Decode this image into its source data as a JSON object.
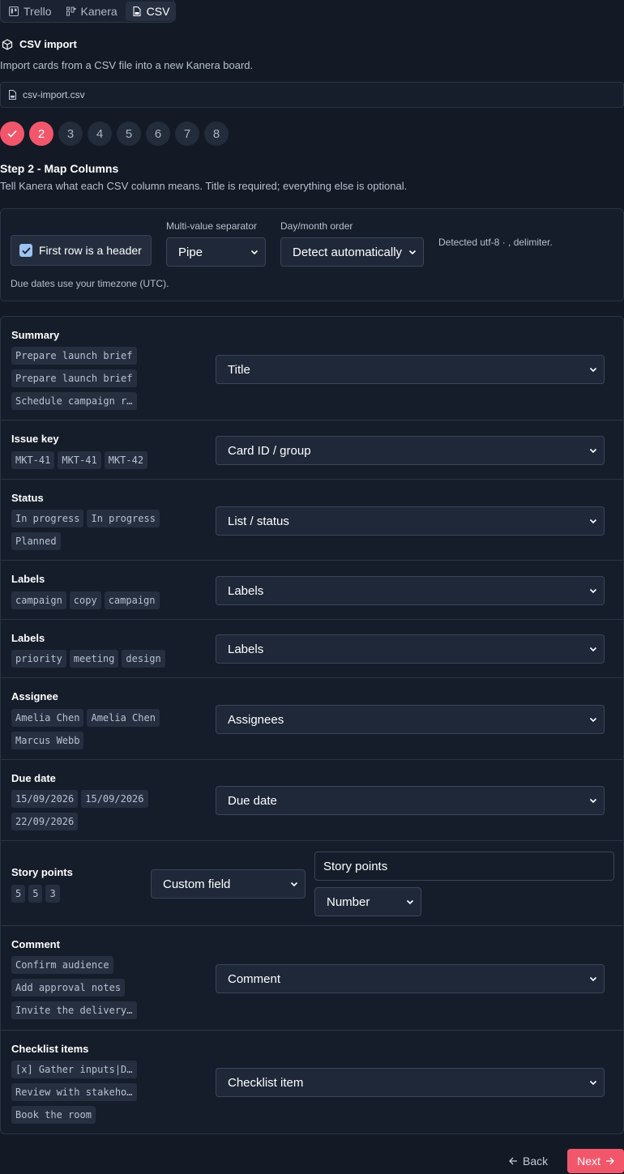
{
  "source_tabs": [
    {
      "label": "Trello",
      "icon": "trello-icon",
      "active": false
    },
    {
      "label": "Kanera",
      "icon": "kanera-icon",
      "active": false
    },
    {
      "label": "CSV",
      "icon": "csv-file-icon",
      "active": true
    }
  ],
  "import": {
    "title": "CSV import",
    "description": "Import cards from a CSV file into a new Kanera board.",
    "file_name": "csv-import.csv"
  },
  "steps": [
    "✓",
    "2",
    "3",
    "4",
    "5",
    "6",
    "7",
    "8"
  ],
  "step": {
    "title": "Step 2 - Map Columns",
    "description": "Tell Kanera what each CSV column means. Title is required; everything else is optional."
  },
  "options": {
    "header_checkbox_label": "First row is a header",
    "header_checked": true,
    "separator_label": "Multi-value separator",
    "separator_value": "Pipe",
    "order_label": "Day/month order",
    "order_value": "Detect automatically",
    "detected": "Detected utf-8 · , delimiter.",
    "timezone_note": "Due dates use your timezone (UTC)."
  },
  "columns": [
    {
      "name": "Summary",
      "samples": [
        "Prepare launch brief",
        "Prepare launch brief",
        "Schedule campaign r…"
      ],
      "mapping": "Title"
    },
    {
      "name": "Issue key",
      "samples": [
        "MKT-41",
        "MKT-41",
        "MKT-42"
      ],
      "mapping": "Card ID / group"
    },
    {
      "name": "Status",
      "samples": [
        "In progress",
        "In progress",
        "Planned"
      ],
      "mapping": "List / status"
    },
    {
      "name": "Labels",
      "samples": [
        "campaign",
        "copy",
        "campaign"
      ],
      "mapping": "Labels"
    },
    {
      "name": "Labels",
      "samples": [
        "priority",
        "meeting",
        "design"
      ],
      "mapping": "Labels"
    },
    {
      "name": "Assignee",
      "samples": [
        "Amelia Chen",
        "Amelia Chen",
        "Marcus Webb"
      ],
      "mapping": "Assignees"
    },
    {
      "name": "Due date",
      "samples": [
        "15/09/2026",
        "15/09/2026",
        "22/09/2026"
      ],
      "mapping": "Due date"
    },
    {
      "name": "Story points",
      "samples": [
        "5",
        "5",
        "3"
      ],
      "mapping": "Custom field",
      "custom_name": "Story points",
      "custom_type": "Number"
    },
    {
      "name": "Comment",
      "samples": [
        "Confirm audience",
        "Add approval notes",
        "Invite the delivery…"
      ],
      "mapping": "Comment"
    },
    {
      "name": "Checklist items",
      "samples": [
        "[x] Gather inputs|D…",
        "Review with stakeho…",
        "Book the room"
      ],
      "mapping": "Checklist item"
    }
  ],
  "nav": {
    "back": "Back",
    "next": "Next"
  },
  "colors": {
    "accent": "#f2566b",
    "background": "#131a26",
    "panel": "#151d2a"
  }
}
